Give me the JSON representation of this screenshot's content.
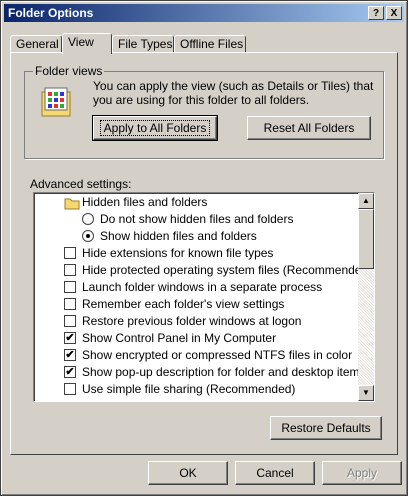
{
  "window": {
    "title": "Folder Options",
    "help_btn": "?",
    "close_btn": "X"
  },
  "tabs": [
    {
      "label": "General"
    },
    {
      "label": "View"
    },
    {
      "label": "File Types"
    },
    {
      "label": "Offline Files"
    }
  ],
  "folder_views": {
    "label": "Folder views",
    "description_line1": "You can apply the view (such as Details or Tiles) that",
    "description_line2": "you are using for this folder to all folders.",
    "apply_btn": "Apply to All Folders",
    "reset_btn": "Reset All Folders"
  },
  "advanced": {
    "label": "Advanced settings:",
    "items": [
      {
        "type": "folder",
        "label": "Hidden files and folders"
      },
      {
        "type": "radio",
        "label": "Do not show hidden files and folders",
        "selected": false
      },
      {
        "type": "radio",
        "label": "Show hidden files and folders",
        "selected": true
      },
      {
        "type": "checkbox",
        "label": "Hide extensions for known file types",
        "checked": false
      },
      {
        "type": "checkbox",
        "label": "Hide protected operating system files (Recommended)",
        "checked": false
      },
      {
        "type": "checkbox",
        "label": "Launch folder windows in a separate process",
        "checked": false
      },
      {
        "type": "checkbox",
        "label": "Remember each folder's view settings",
        "checked": false
      },
      {
        "type": "checkbox",
        "label": "Restore previous folder windows at logon",
        "checked": false
      },
      {
        "type": "checkbox",
        "label": "Show Control Panel in My Computer",
        "checked": true
      },
      {
        "type": "checkbox",
        "label": "Show encrypted or compressed NTFS files in color",
        "checked": true
      },
      {
        "type": "checkbox",
        "label": "Show pop-up description for folder and desktop items",
        "checked": true
      },
      {
        "type": "checkbox",
        "label": "Use simple file sharing (Recommended)",
        "checked": false
      }
    ],
    "check_mark": "✔"
  },
  "restore_defaults_btn": "Restore Defaults",
  "dialog": {
    "ok": "OK",
    "cancel": "Cancel",
    "apply": "Apply"
  }
}
